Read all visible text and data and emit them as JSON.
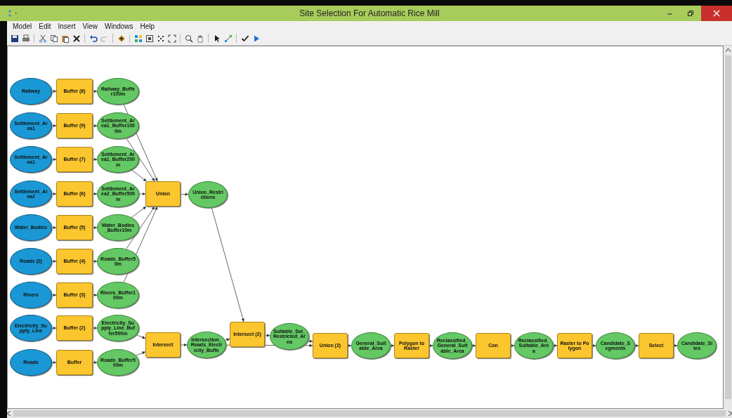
{
  "window": {
    "title": "Site Selection For Automatic Rice Mill"
  },
  "menu": [
    "Model",
    "Edit",
    "Insert",
    "View",
    "Windows",
    "Help"
  ],
  "model_nodes": [
    {
      "kind": "input",
      "label": "Railway"
    },
    {
      "kind": "tool",
      "label": "Buffer (8)"
    },
    {
      "kind": "output",
      "label": "Railway_Buffer100m"
    },
    {
      "kind": "input",
      "label": "Settlement_Area1"
    },
    {
      "kind": "tool",
      "label": "Buffer (9)"
    },
    {
      "kind": "output",
      "label": "Settlement_Area1_Buffer1000m"
    },
    {
      "kind": "input",
      "label": "Settlement_Area1"
    },
    {
      "kind": "tool",
      "label": "Buffer (7)"
    },
    {
      "kind": "output",
      "label": "Settlement_Area1_Buffer200m"
    },
    {
      "kind": "input",
      "label": "Settlement_Area2"
    },
    {
      "kind": "tool",
      "label": "Buffer (6)"
    },
    {
      "kind": "output",
      "label": "Settlement_Area2_Buffer500m"
    },
    {
      "kind": "input",
      "label": "Water_Bodies"
    },
    {
      "kind": "tool",
      "label": "Buffer (5)"
    },
    {
      "kind": "output",
      "label": "Water_Bodies_Buffer10m"
    },
    {
      "kind": "input",
      "label": "Roads (2)"
    },
    {
      "kind": "tool",
      "label": "Buffer (4)"
    },
    {
      "kind": "output",
      "label": "Roads_Buffer50m"
    },
    {
      "kind": "input",
      "label": "Rivers"
    },
    {
      "kind": "tool",
      "label": "Buffer (3)"
    },
    {
      "kind": "output",
      "label": "Rivers_Buffer100m"
    },
    {
      "kind": "input",
      "label": "Electricity_Supply_Line"
    },
    {
      "kind": "tool",
      "label": "Buffer (2)"
    },
    {
      "kind": "output",
      "label": "Electricity_Supply_Line_Buffer500m"
    },
    {
      "kind": "input",
      "label": "Roads"
    },
    {
      "kind": "tool",
      "label": "Buffer"
    },
    {
      "kind": "output",
      "label": "Roads_Buffer500m"
    },
    {
      "kind": "tool",
      "label": "Union"
    },
    {
      "kind": "output",
      "label": "Union_Restrictions"
    },
    {
      "kind": "tool",
      "label": "Intersect"
    },
    {
      "kind": "output",
      "label": "Intersection_Roads_Electricity_Buffe"
    },
    {
      "kind": "tool",
      "label": "Intersect (2)"
    },
    {
      "kind": "output",
      "label": "Suitable_Sol_Restricted_Area"
    },
    {
      "kind": "tool",
      "label": "Union (2)"
    },
    {
      "kind": "output",
      "label": "General_Suitable_Area"
    },
    {
      "kind": "tool",
      "label": "Polygon to Raster"
    },
    {
      "kind": "output",
      "label": "Reclassified_General_Suitable_Area"
    },
    {
      "kind": "tool",
      "label": "Con"
    },
    {
      "kind": "output",
      "label": "Reclassified_Suitable_Area"
    },
    {
      "kind": "tool",
      "label": "Raster to Polygon"
    },
    {
      "kind": "output",
      "label": "Candidate_Segments"
    },
    {
      "kind": "tool",
      "label": "Select"
    },
    {
      "kind": "output",
      "label": "Candidate_Sites"
    }
  ]
}
